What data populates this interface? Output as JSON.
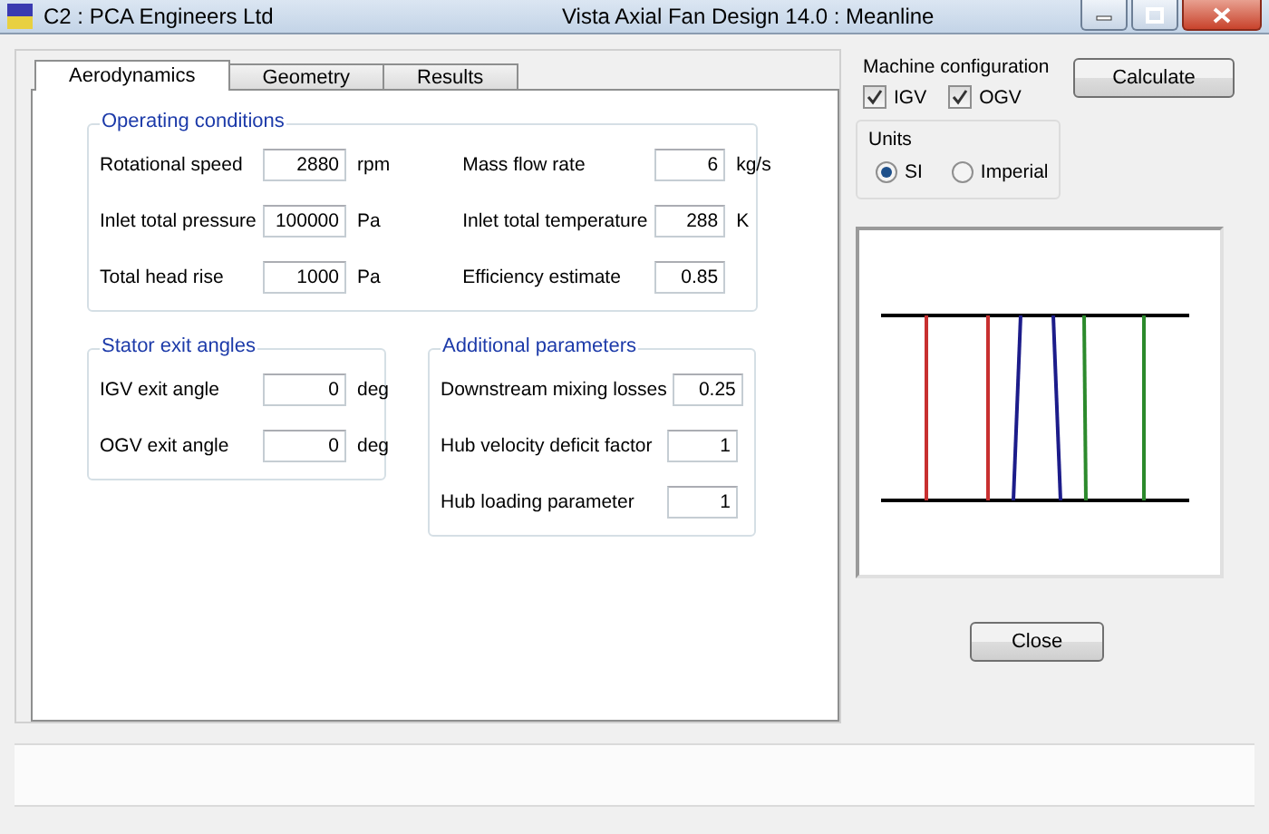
{
  "window": {
    "app_label": "C2 : PCA Engineers Ltd",
    "title": "Vista Axial Fan Design 14.0 : Meanline"
  },
  "tabs": [
    {
      "label": "Aerodynamics",
      "selected": true
    },
    {
      "label": "Geometry",
      "selected": false
    },
    {
      "label": "Results",
      "selected": false
    }
  ],
  "operating_conditions": {
    "title": "Operating conditions",
    "left_fields": [
      {
        "label": "Rotational speed",
        "value": "2880",
        "unit": "rpm"
      },
      {
        "label": "Inlet total pressure",
        "value": "100000",
        "unit": "Pa"
      },
      {
        "label": "Total head rise",
        "value": "1000",
        "unit": "Pa"
      }
    ],
    "right_fields": [
      {
        "label": "Mass flow rate",
        "value": "6",
        "unit": "kg/s"
      },
      {
        "label": "Inlet total temperature",
        "value": "288",
        "unit": "K"
      },
      {
        "label": "Efficiency estimate",
        "value": "0.85"
      }
    ]
  },
  "stator_exit_angles": {
    "title": "Stator exit angles",
    "fields": [
      {
        "label": "IGV exit angle",
        "value": "0",
        "unit": "deg"
      },
      {
        "label": "OGV exit angle",
        "value": "0",
        "unit": "deg"
      }
    ]
  },
  "additional_parameters": {
    "title": "Additional parameters",
    "fields": [
      {
        "label": "Downstream mixing losses",
        "value": "0.25"
      },
      {
        "label": "Hub velocity deficit factor",
        "value": "1"
      },
      {
        "label": "Hub loading parameter",
        "value": "1"
      }
    ]
  },
  "machine_configuration": {
    "title": "Machine configuration",
    "checkboxes": [
      {
        "label": "IGV",
        "checked": true
      },
      {
        "label": "OGV",
        "checked": true
      }
    ]
  },
  "calculate_button": "Calculate",
  "units": {
    "title": "Units",
    "options": [
      {
        "label": "SI",
        "selected": true
      },
      {
        "label": "Imperial",
        "selected": false
      }
    ]
  },
  "close_button": "Close"
}
